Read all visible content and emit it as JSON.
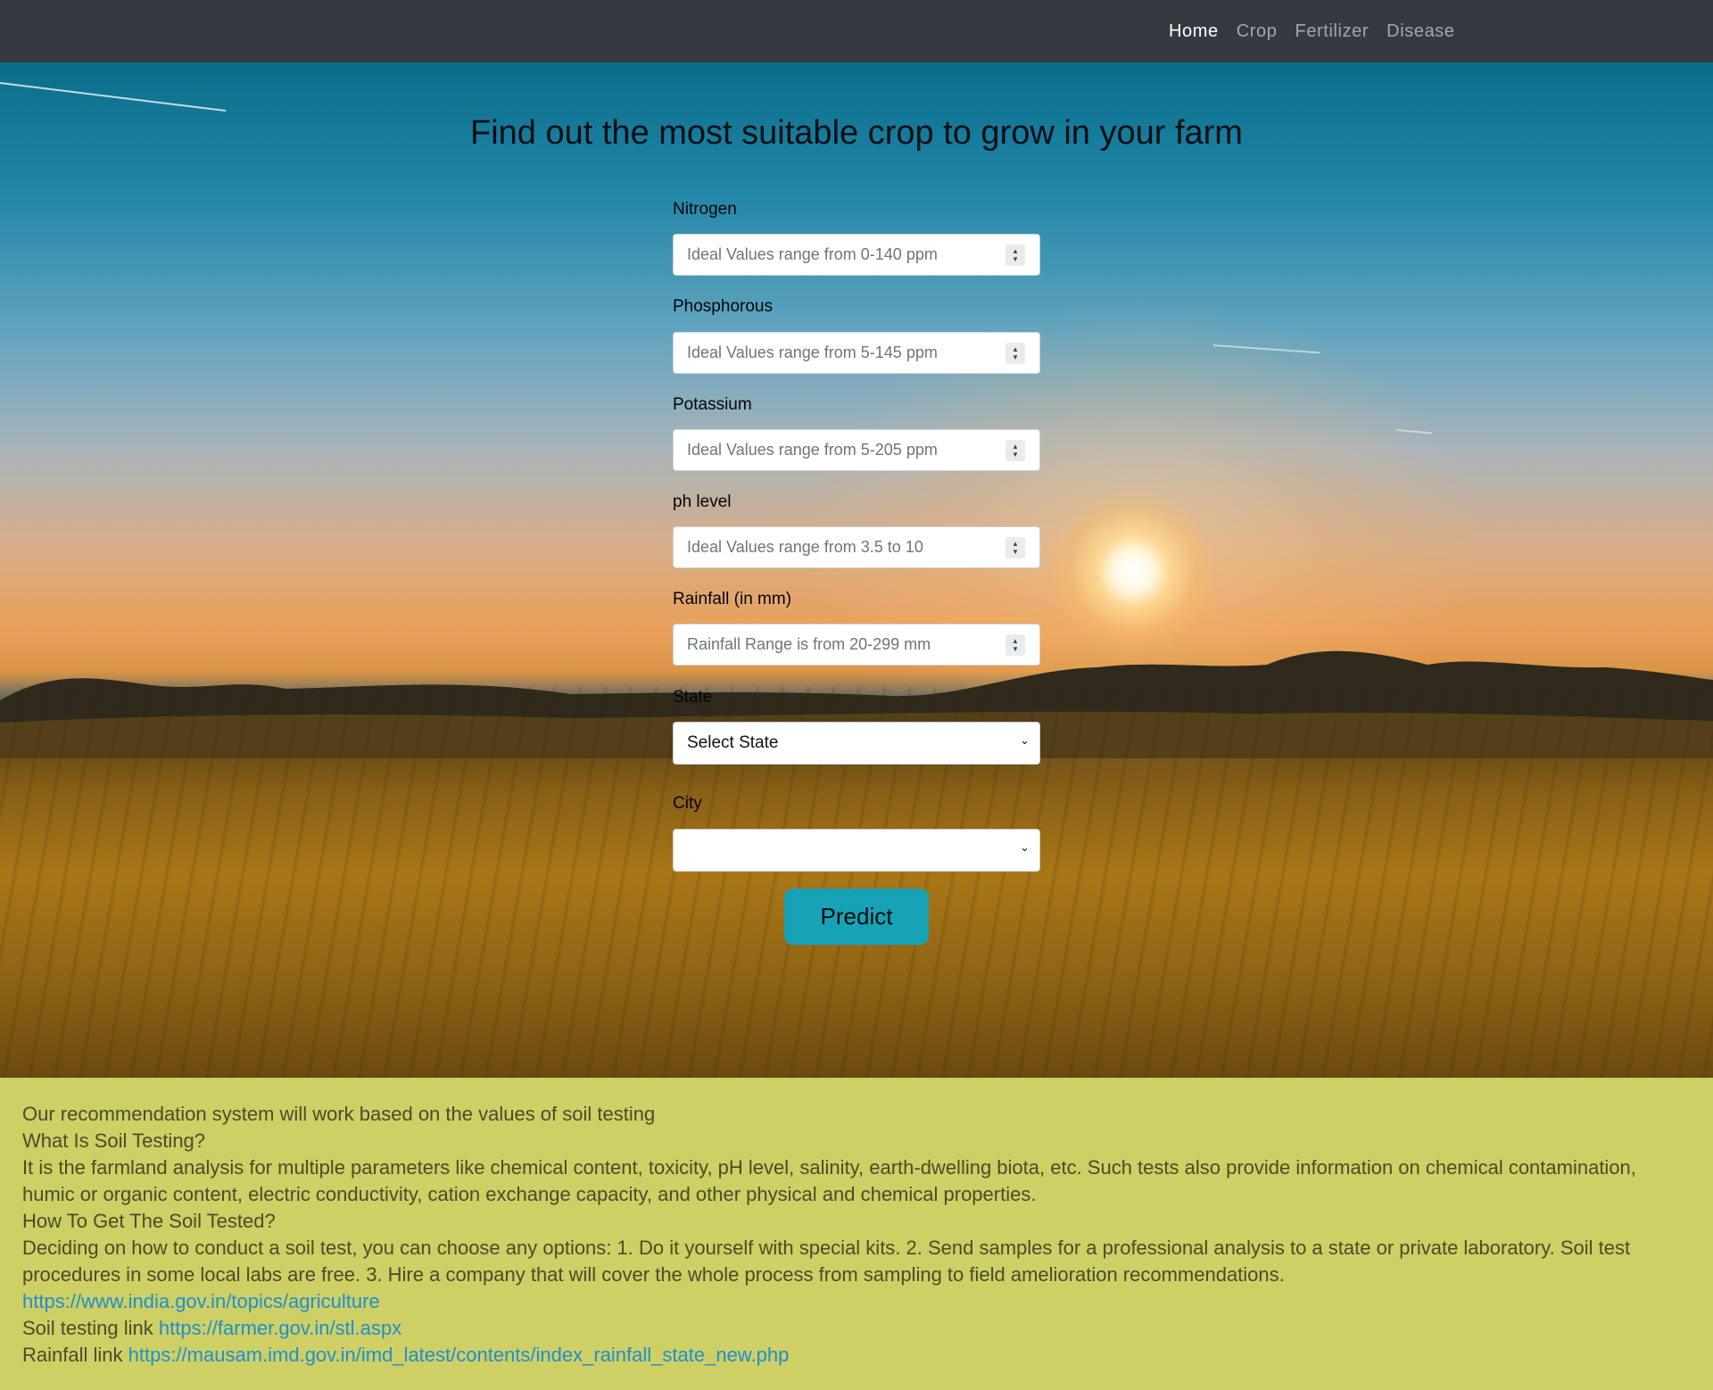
{
  "nav": {
    "items": [
      {
        "label": "Home"
      },
      {
        "label": "Crop"
      },
      {
        "label": "Fertilizer"
      },
      {
        "label": "Disease"
      }
    ]
  },
  "form": {
    "title": "Find out the most suitable crop to grow in your farm",
    "fields": [
      {
        "label": "Nitrogen",
        "placeholder": "Ideal Values range from 0-140 ppm"
      },
      {
        "label": "Phosphorous",
        "placeholder": "Ideal Values range from 5-145 ppm"
      },
      {
        "label": "Potassium",
        "placeholder": "Ideal Values range from 5-205 ppm"
      },
      {
        "label": "ph level",
        "placeholder": "Ideal Values range from 3.5 to 10"
      },
      {
        "label": "Rainfall (in mm)",
        "placeholder": "Rainfall Range is from 20-299 mm"
      }
    ],
    "state": {
      "label": "State",
      "selected": "Select State"
    },
    "city": {
      "label": "City",
      "selected": ""
    },
    "submit_label": "Predict"
  },
  "info": {
    "intro": "Our recommendation system will work based on the values of soil testing",
    "q1": "What Is Soil Testing?",
    "a1": "It is the farmland analysis for multiple parameters like chemical content, toxicity, pH level, salinity, earth-dwelling biota, etc. Such tests also provide information on chemical contamination, humic or organic content, electric conductivity, cation exchange capacity, and other physical and chemical properties.",
    "q2": "How To Get The Soil Tested?",
    "a2": "Deciding on how to conduct a soil test, you can choose any options: 1. Do it yourself with special kits. 2. Send samples for a professional analysis to a state or private laboratory. Soil test procedures in some local labs are free. 3. Hire a company that will cover the whole process from sampling to field amelioration recommendations.",
    "agri_link": "https://www.india.gov.in/topics/agriculture",
    "soil_prefix": "Soil testing link",
    "soil_link": "https://farmer.gov.in/stl.aspx",
    "rain_prefix": "Rainfall link",
    "rain_link": "https://mausam.imd.gov.in/imd_latest/contents/index_rainfall_state_new.php"
  },
  "colors": {
    "navbar": "#343a40",
    "button": "#17a2b8",
    "info_bg": "#cecf64",
    "link": "#1f8fd0"
  }
}
